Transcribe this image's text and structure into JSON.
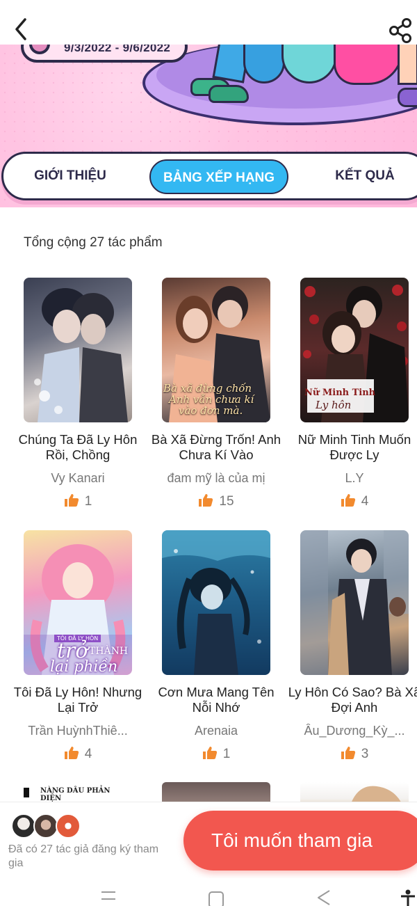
{
  "header": {
    "date_range": "9/3/2022 - 9/6/2022"
  },
  "tabs": [
    {
      "label": "GIỚI THIỆU",
      "active": false
    },
    {
      "label": "BẢNG XẾP HẠNG",
      "active": true
    },
    {
      "label": "KẾT QUẢ",
      "active": false
    }
  ],
  "summary": {
    "total_label": "Tổng cộng 27 tác phẩm"
  },
  "works": [
    {
      "title": "Chúng Ta Đã Ly Hôn Rồi, Chồng",
      "author": "Vy Kanari",
      "likes": "1"
    },
    {
      "title": "Bà Xã Đừng Trốn! Anh Chưa Kí Vào",
      "author": "đam mỹ là của mị",
      "likes": "15"
    },
    {
      "title": "Nữ Minh Tinh Muốn Được Ly",
      "author": "L.Y",
      "likes": "4"
    },
    {
      "title": "Tôi Đã Ly Hôn! Nhưng Lại Trở",
      "author": "Trần HuỳnhThiê...",
      "likes": "4"
    },
    {
      "title": "Cơn Mưa Mang Tên Nỗi Nhớ",
      "author": "Arenaia",
      "likes": "1"
    },
    {
      "title": "Ly Hôn Có Sao? Bà Xã Đợi Anh",
      "author": "Âu_Dương_Kỳ_...",
      "likes": "3"
    }
  ],
  "cover_text": {
    "c2_line1": "Bà xã đừng chốn",
    "c2_line2": "Anh vẫn chưa kí",
    "c2_line3": "vào đơn mà.",
    "c3_line1": "Nữ Minh Tinh",
    "c3_line2": "Ly hôn",
    "c4_line1": "TÔI ĐÃ LY HÔN",
    "c4_line2": "trở",
    "c4_line3": "THÀNH",
    "c4_line4": "lại phiền",
    "peek1": "NÀNG DÂU PHẢN DIỆN"
  },
  "bottom": {
    "joined_text": "Đã có 27 tác giả đăng ký tham gia",
    "join_button": "Tôi muốn tham gia"
  },
  "colors": {
    "accent_blue": "#33b8f2",
    "join_red": "#f2574f",
    "like_orange": "#f28a2e",
    "banner_pink": "#ffc4e2",
    "outline": "#2d2a4a"
  },
  "icons": {
    "back": "chevron-left-icon",
    "share": "share-icon",
    "like": "thumbs-up-icon"
  }
}
